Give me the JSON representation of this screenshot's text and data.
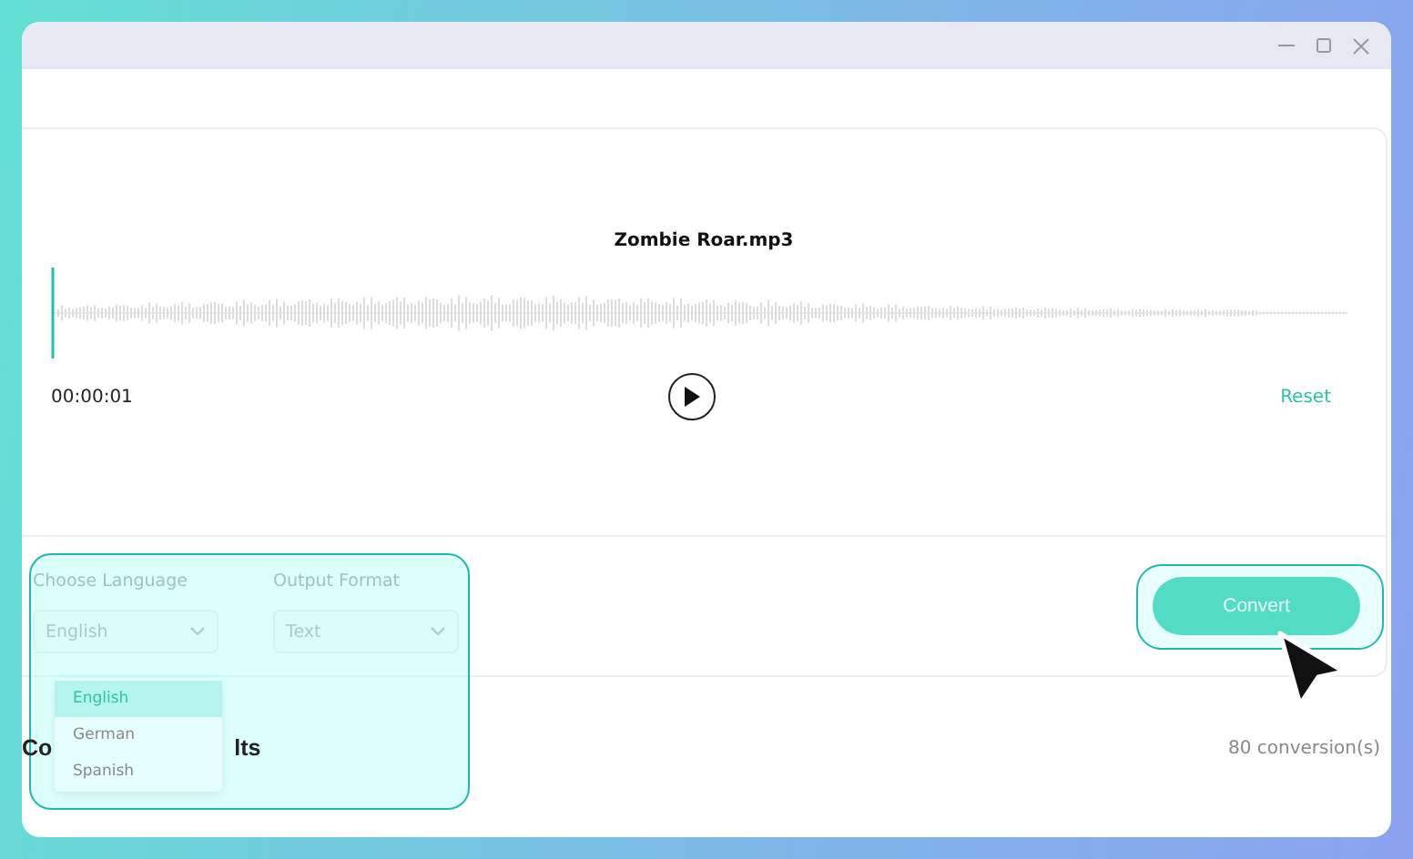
{
  "player": {
    "file_name": "Zombie Roar.mp3",
    "time": "00:00:01",
    "reset_label": "Reset",
    "playing": false
  },
  "settings": {
    "language": {
      "label": "Choose Language",
      "value": "English",
      "expanded": true,
      "options": [
        {
          "label": "English",
          "selected": true
        },
        {
          "label": "German",
          "selected": false
        },
        {
          "label": "Spanish",
          "selected": false
        }
      ]
    },
    "output_format": {
      "label": "Output Format",
      "value": "Text"
    }
  },
  "convert_button": {
    "label": "Convert"
  },
  "results": {
    "heading_visible_parts": [
      "Co",
      "lts"
    ],
    "count": "80 conversion(s)"
  }
}
